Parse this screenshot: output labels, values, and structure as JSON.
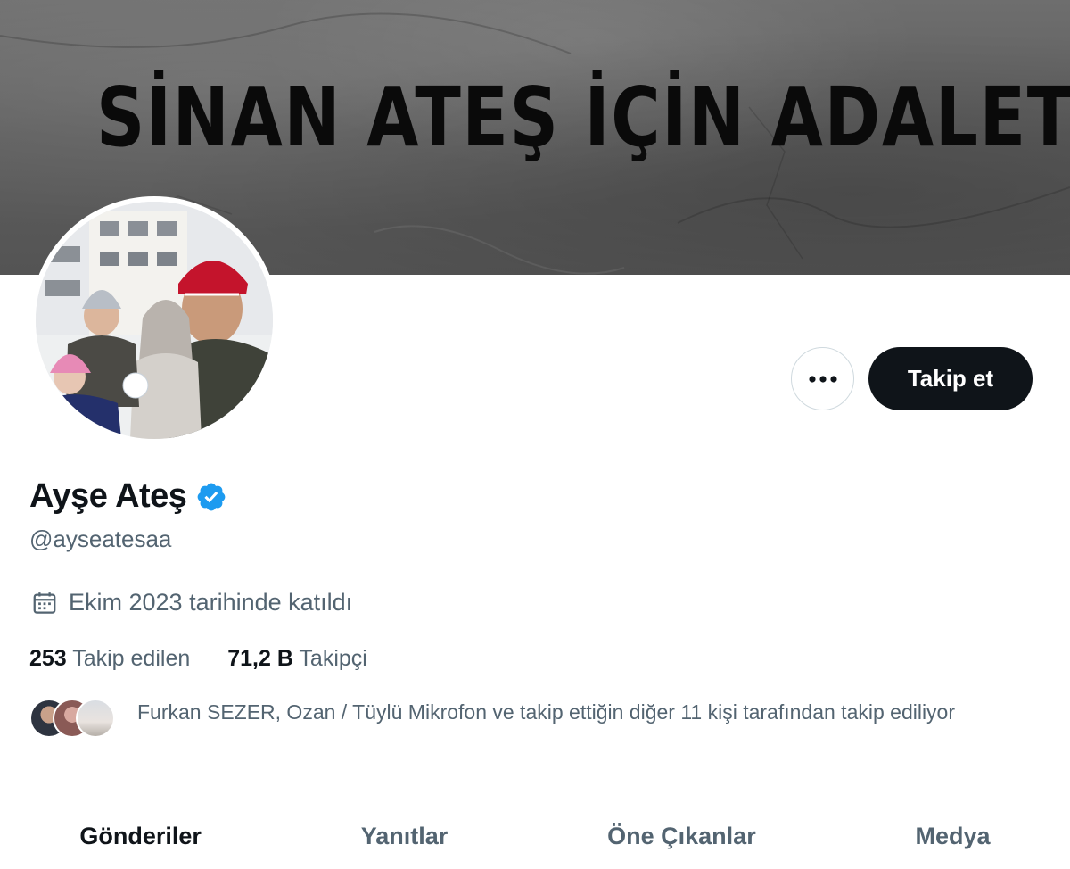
{
  "banner": {
    "text": "SİNAN ATEŞ İÇİN ADALET!"
  },
  "actions": {
    "more_label": "···",
    "follow_label": "Takip et"
  },
  "profile": {
    "display_name": "Ayşe Ateş",
    "handle": "@ayseatesaa",
    "joined": "Ekim 2023 tarihinde katıldı",
    "following_count": "253",
    "following_label": "Takip edilen",
    "followers_count": "71,2 B",
    "followers_label": "Takipçi",
    "followed_by": "Furkan SEZER, Ozan / Tüylü Mikrofon ve takip ettiğin diğer 11 kişi tarafından takip ediliyor"
  },
  "tabs": [
    {
      "label": "Gönderiler"
    },
    {
      "label": "Yanıtlar"
    },
    {
      "label": "Öne Çıkanlar"
    },
    {
      "label": "Medya"
    }
  ],
  "colors": {
    "text_primary": "#0f1419",
    "text_secondary": "#536471",
    "verified": "#1d9bf0",
    "button_dark": "#0f1419",
    "border": "#cfd9de"
  },
  "icons": {
    "verified": "verified-badge-icon",
    "calendar": "calendar-icon",
    "more": "more-horizontal-icon"
  }
}
